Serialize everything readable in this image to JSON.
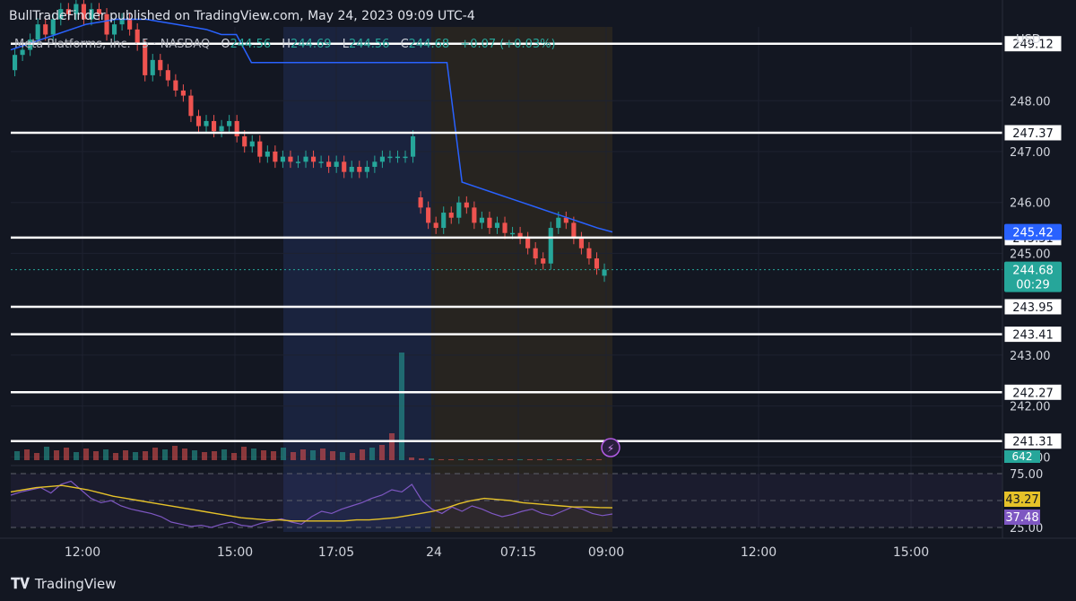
{
  "header": {
    "published_text": "BullTradeFinder published on TradingView.com, May 24, 2023 09:09 UTC-4"
  },
  "legend": {
    "symbol": "Meta Platforms, Inc. · 5 · NASDAQ",
    "o_label": "O",
    "o_value": "244.56",
    "h_label": "H",
    "h_value": "244.69",
    "l_label": "L",
    "l_value": "244.56",
    "c_label": "C",
    "c_value": "244.68",
    "change": "+0.07 (+0.03%)"
  },
  "currency": "USD",
  "footer": {
    "brand": "TradingView"
  },
  "colors": {
    "up": "#26a69a",
    "down": "#ef5350",
    "vwap": "#2962ff",
    "rsi": "#7e57c2",
    "rsi_ma": "#e6c229",
    "level_line": "#ffffff",
    "premarket_shade": "#1e2a4a",
    "afterhours_shade": "#2a2620"
  },
  "chart_data": {
    "type": "candlestick",
    "price_axis": {
      "range": [
        240.9,
        249.45
      ],
      "ticks": [
        "248.00",
        "247.00",
        "246.00",
        "245.00",
        "243.00",
        "242.00",
        "241.00"
      ]
    },
    "time_axis": {
      "ticks": [
        "12:00",
        "15:00",
        "17:05",
        "24",
        "07:15",
        "09:00",
        "12:00",
        "15:00"
      ]
    },
    "support_resistance_levels": [
      "249.12",
      "247.37",
      "245.31",
      "243.95",
      "243.41",
      "242.27",
      "241.31"
    ],
    "price_labels": {
      "vwap": "245.42",
      "last": "244.68",
      "countdown": "00:29"
    },
    "volume_label": "642",
    "rsi": {
      "range": [
        25,
        75
      ],
      "ticks": [
        "75.00",
        "25.00"
      ],
      "value": "37.48",
      "ma_value": "43.27"
    },
    "candles_close": [
      248.9,
      249.0,
      249.2,
      249.5,
      249.3,
      249.6,
      249.8,
      249.7,
      249.9,
      249.6,
      249.8,
      249.7,
      249.3,
      249.5,
      249.6,
      249.4,
      249.1,
      248.5,
      248.8,
      248.6,
      248.4,
      248.2,
      248.1,
      247.7,
      247.5,
      247.6,
      247.4,
      247.5,
      247.6,
      247.3,
      247.1,
      247.2,
      246.9,
      247.0,
      246.8,
      246.9,
      246.8,
      246.8,
      246.9,
      246.8,
      246.8,
      246.7,
      246.8,
      246.6,
      246.7,
      246.6,
      246.7,
      246.8,
      246.9,
      246.9,
      246.9,
      246.9,
      247.3,
      245.9,
      245.6,
      245.5,
      245.8,
      245.7,
      246.0,
      245.9,
      245.6,
      245.7,
      245.5,
      245.6,
      245.4,
      245.4,
      245.3,
      245.1,
      244.9,
      244.8,
      245.5,
      245.7,
      245.6,
      245.3,
      245.1,
      244.9,
      244.7,
      244.68
    ],
    "candles_open": [
      248.6,
      248.9,
      249.0,
      249.2,
      249.5,
      249.3,
      249.6,
      249.8,
      249.7,
      249.9,
      249.6,
      249.8,
      249.7,
      249.3,
      249.5,
      249.6,
      249.4,
      249.1,
      248.5,
      248.8,
      248.6,
      248.4,
      248.2,
      248.1,
      247.7,
      247.5,
      247.6,
      247.4,
      247.5,
      247.6,
      247.3,
      247.1,
      247.2,
      246.9,
      247.0,
      246.8,
      246.9,
      246.8,
      246.8,
      246.9,
      246.8,
      246.8,
      246.7,
      246.8,
      246.6,
      246.7,
      246.6,
      246.7,
      246.8,
      246.9,
      246.9,
      246.9,
      246.9,
      246.1,
      245.9,
      245.6,
      245.5,
      245.8,
      245.7,
      246.0,
      245.9,
      245.6,
      245.7,
      245.5,
      245.6,
      245.4,
      245.4,
      245.3,
      245.1,
      244.9,
      244.8,
      245.5,
      245.7,
      245.6,
      245.3,
      245.1,
      244.9,
      244.56
    ],
    "vwap_series": [
      249.0,
      249.1,
      249.2,
      249.3,
      249.4,
      249.5,
      249.55,
      249.6,
      249.6,
      249.6,
      249.55,
      249.5,
      249.45,
      249.4,
      249.3,
      249.3,
      248.75,
      248.75,
      248.75,
      248.75,
      248.75,
      248.75,
      248.75,
      248.75,
      248.75,
      248.75,
      248.75,
      248.75,
      248.75,
      248.75,
      246.4,
      246.3,
      246.2,
      246.1,
      246.0,
      245.9,
      245.8,
      245.7,
      245.6,
      245.5,
      245.42
    ],
    "rsi_series": [
      55,
      58,
      60,
      62,
      57,
      65,
      68,
      60,
      52,
      48,
      50,
      45,
      42,
      40,
      38,
      35,
      30,
      28,
      26,
      27,
      25,
      28,
      30,
      27,
      26,
      29,
      31,
      33,
      30,
      28,
      35,
      40,
      38,
      42,
      45,
      48,
      52,
      55,
      60,
      58,
      65,
      50,
      42,
      38,
      44,
      40,
      45,
      42,
      38,
      35,
      37,
      40,
      42,
      38,
      36,
      40,
      44,
      42,
      38,
      36,
      37.48
    ],
    "rsi_ma_series": [
      58,
      60,
      62,
      63,
      64,
      62,
      60,
      57,
      54,
      52,
      50,
      48,
      46,
      44,
      42,
      40,
      38,
      36,
      34,
      33,
      32,
      32,
      31,
      31,
      31,
      31,
      31,
      32,
      32,
      33,
      34,
      36,
      38,
      40,
      43,
      47,
      50,
      52,
      51,
      50,
      48,
      47,
      46,
      45,
      44,
      44,
      43.5,
      43.27
    ],
    "volume_series": [
      10,
      12,
      8,
      15,
      11,
      14,
      9,
      13,
      10,
      12,
      8,
      11,
      9,
      10,
      14,
      12,
      16,
      13,
      11,
      9,
      10,
      12,
      8,
      15,
      13,
      11,
      10,
      14,
      9,
      12,
      11,
      13,
      10,
      9,
      8,
      12,
      14,
      17,
      30,
      120,
      3,
      2,
      2,
      1,
      1,
      1,
      1,
      1,
      1,
      1,
      1,
      1,
      1,
      1,
      1,
      1,
      1,
      1,
      1,
      1
    ]
  }
}
